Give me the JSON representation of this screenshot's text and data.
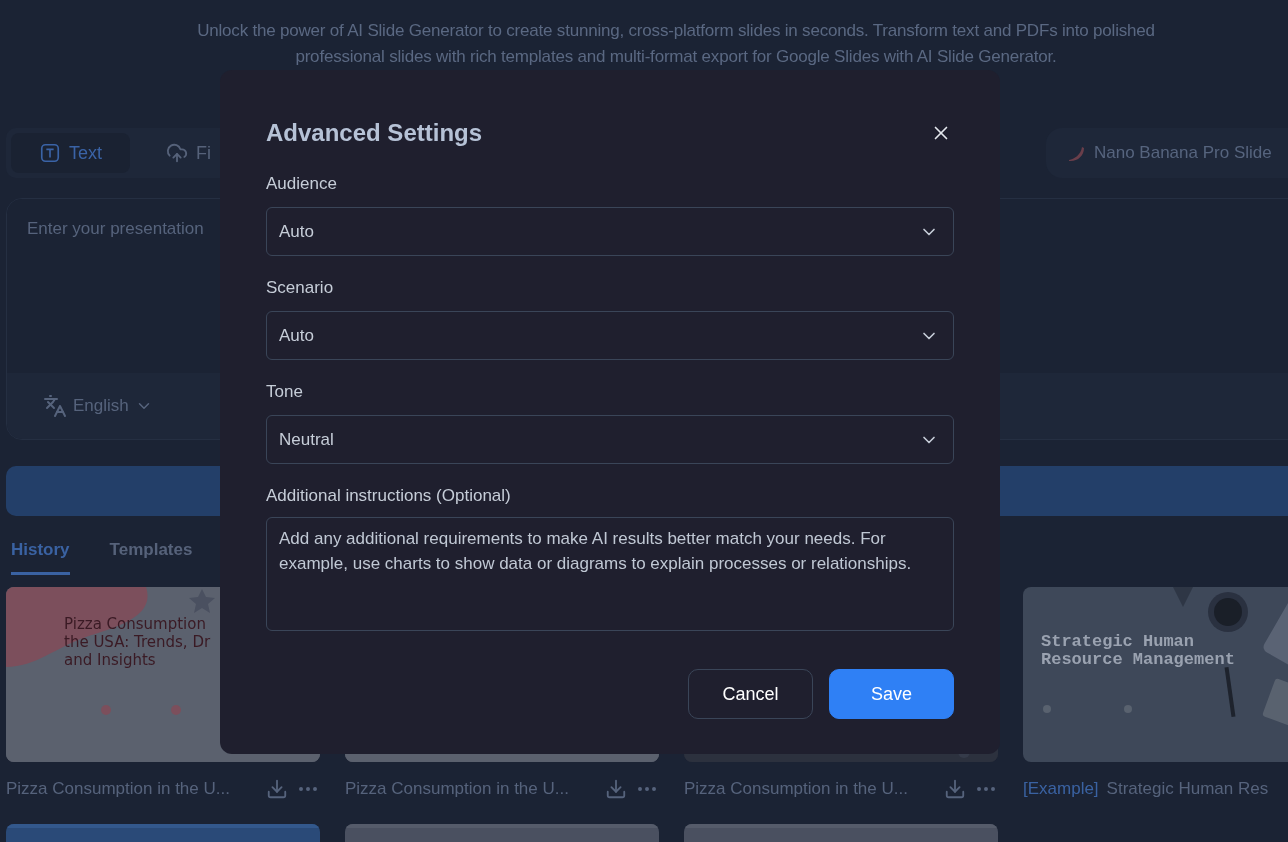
{
  "page": {
    "subtitle": [
      "Unlock the power of AI Slide Generator to create stunning, cross-platform slides in seconds. Transform text and PDFs into polished",
      "professional slides with rich templates and multi-format export for Google Slides with AI Slide Generator."
    ]
  },
  "input_tabs": [
    {
      "label": "Text",
      "kind": "text",
      "selected": true
    },
    {
      "label": "Fi",
      "kind": "upload",
      "selected": false
    }
  ],
  "model_button": {
    "label": "Nano Banana Pro Slide"
  },
  "prompt": {
    "placeholder": "Enter your presentation"
  },
  "language": {
    "value": "English"
  },
  "section_tabs": [
    {
      "label": "History",
      "selected": true
    },
    {
      "label": "Templates",
      "selected": false
    }
  ],
  "cards": [
    {
      "kind": "pizza",
      "slide_title": [
        "Pizza Consumption",
        "the USA: Trends, Dr",
        "and Insights"
      ],
      "caption": "Pizza Consumption in the U..."
    },
    {
      "kind": "pizza",
      "caption": "Pizza Consumption in the U..."
    },
    {
      "kind": "dark",
      "caption": "Pizza Consumption in the U..."
    },
    {
      "kind": "office",
      "slide_title": [
        "Strategic Human",
        "Resource Management"
      ],
      "tag": "[Example]",
      "caption": "Strategic Human Res"
    }
  ],
  "more_cards": [
    {
      "kind": "blue"
    },
    {
      "kind": "grey"
    },
    {
      "kind": "grey"
    }
  ],
  "dialog": {
    "title": "Advanced Settings",
    "fields": [
      {
        "label": "Audience",
        "value": "Auto"
      },
      {
        "label": "Scenario",
        "value": "Auto"
      },
      {
        "label": "Tone",
        "value": "Neutral"
      }
    ],
    "instructions": {
      "label": "Additional instructions (Optional)",
      "placeholder": "Add any additional requirements to make AI results better match your needs. For example, use charts to show data or diagrams to explain processes or relationships."
    },
    "buttons": [
      {
        "label": "Cancel",
        "kind": "secondary"
      },
      {
        "label": "Save",
        "kind": "primary"
      }
    ]
  }
}
